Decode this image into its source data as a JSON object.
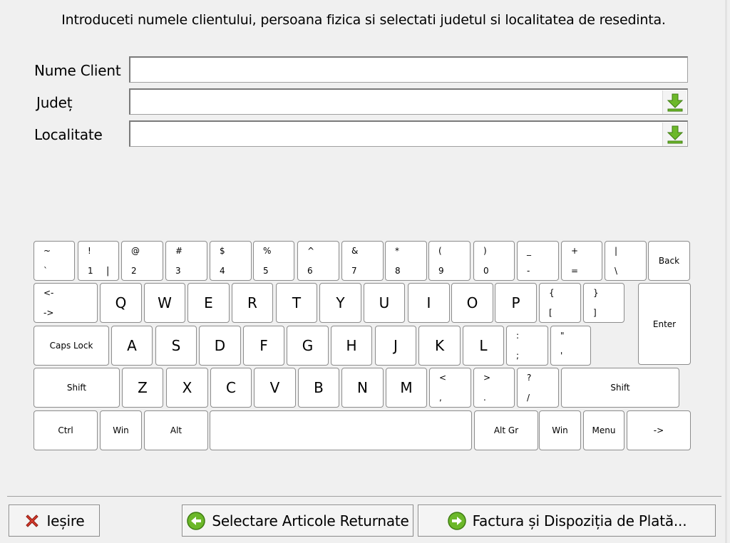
{
  "instruction": "Introduceti numele clientului, persoana fizica si selectati judetul si localitatea de resedinta.",
  "form": {
    "nume_label": "Nume Client",
    "nume_value": "",
    "judet_label": "Județ",
    "judet_value": "",
    "localitate_label": "Localitate",
    "localitate_value": "",
    "dropdown_icon": "download-arrow-icon"
  },
  "keyboard": {
    "row1": [
      {
        "top": "~",
        "bot": "`"
      },
      {
        "top": "!",
        "bot": "1",
        "extra": "|"
      },
      {
        "top": "@",
        "bot": "2"
      },
      {
        "top": "#",
        "bot": "3"
      },
      {
        "top": "$",
        "bot": "4"
      },
      {
        "top": "%",
        "bot": "5"
      },
      {
        "top": "^",
        "bot": "6"
      },
      {
        "top": "&",
        "bot": "7"
      },
      {
        "top": "*",
        "bot": "8"
      },
      {
        "top": "(",
        "bot": "9"
      },
      {
        "top": ")",
        "bot": "0"
      },
      {
        "top": "_",
        "bot": "-"
      },
      {
        "top": "+",
        "bot": "="
      },
      {
        "top": "|",
        "bot": "\\"
      },
      {
        "label": "Back"
      }
    ],
    "row2": [
      {
        "top": "<-",
        "bot": "->"
      },
      {
        "big": "Q"
      },
      {
        "big": "W"
      },
      {
        "big": "E"
      },
      {
        "big": "R"
      },
      {
        "big": "T"
      },
      {
        "big": "Y"
      },
      {
        "big": "U"
      },
      {
        "big": "I"
      },
      {
        "big": "O"
      },
      {
        "big": "P"
      },
      {
        "top": "{",
        "bot": "["
      },
      {
        "top": "}",
        "bot": "]"
      },
      {
        "label": "Enter"
      }
    ],
    "row3": [
      {
        "label": "Caps Lock"
      },
      {
        "big": "A"
      },
      {
        "big": "S"
      },
      {
        "big": "D"
      },
      {
        "big": "F"
      },
      {
        "big": "G"
      },
      {
        "big": "H"
      },
      {
        "big": "J"
      },
      {
        "big": "K"
      },
      {
        "big": "L"
      },
      {
        "top": ":",
        "bot": ";"
      },
      {
        "top": "\"",
        "bot": "'"
      }
    ],
    "row4": [
      {
        "label": "Shift"
      },
      {
        "big": "Z"
      },
      {
        "big": "X"
      },
      {
        "big": "C"
      },
      {
        "big": "V"
      },
      {
        "big": "B"
      },
      {
        "big": "N"
      },
      {
        "big": "M"
      },
      {
        "top": "<",
        "bot": ","
      },
      {
        "top": ">",
        "bot": "."
      },
      {
        "top": "?",
        "bot": "/"
      },
      {
        "label": "Shift"
      }
    ],
    "row5": [
      {
        "label": "Ctrl"
      },
      {
        "label": "Win"
      },
      {
        "label": "Alt"
      },
      {
        "label": ""
      },
      {
        "label": "Alt Gr"
      },
      {
        "label": "Win"
      },
      {
        "label": "Menu"
      },
      {
        "label": "->"
      }
    ]
  },
  "buttons": {
    "exit_label": "Ieșire",
    "exit_icon": "red-x-icon",
    "select_label": "Selectare Articole Returnate",
    "select_icon": "green-back-arrow-icon",
    "invoice_label": "Factura și Dispoziția de Plată...",
    "invoice_icon": "green-forward-arrow-icon"
  },
  "colors": {
    "background": "#f0f0f0",
    "arrow_green": "#6cb82a",
    "exit_red": "#d83a2c"
  }
}
